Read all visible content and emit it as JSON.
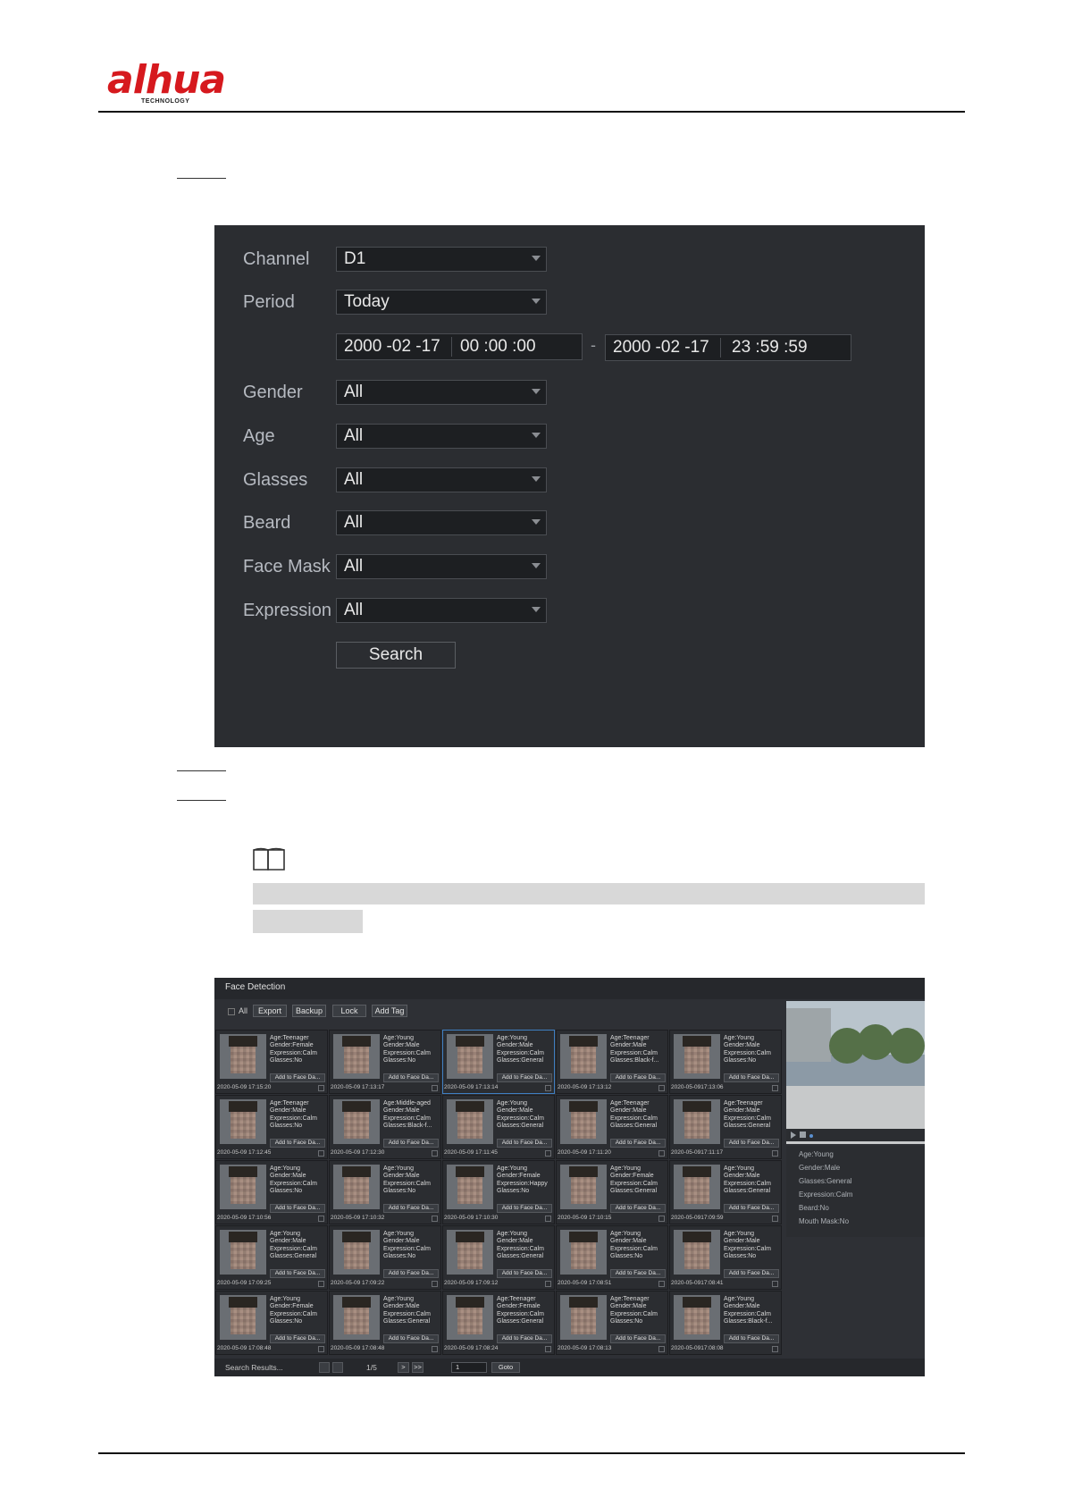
{
  "logo": {
    "brand": "alhua",
    "sub": "TECHNOLOGY"
  },
  "search_form": {
    "labels": {
      "channel": "Channel",
      "period": "Period",
      "gender": "Gender",
      "age": "Age",
      "glasses": "Glasses",
      "beard": "Beard",
      "face_mask": "Face Mask",
      "expression": "Expression"
    },
    "values": {
      "channel": "D1",
      "period": "Today",
      "gender": "All",
      "age": "All",
      "glasses": "All",
      "beard": "All",
      "face_mask": "All",
      "expression": "All"
    },
    "start_date": "2000 -02 -17",
    "start_time": "00 :00 :00",
    "end_date": "2000 -02 -17",
    "end_time": "23 :59 :59",
    "dash": "-",
    "search_label": "Search"
  },
  "results": {
    "title": "Face Detection",
    "toolbar": {
      "all": "All",
      "export": "Export",
      "backup": "Backup",
      "lock": "Lock",
      "add_tag": "Add Tag"
    },
    "add_label": "Add to Face Da...",
    "cards": [
      {
        "l1": "Age:Teenager",
        "l2": "Gender:Female",
        "l3": "Expression:Calm",
        "l4": "Glasses:No",
        "time": "2020-05-09 17:15:20"
      },
      {
        "l1": "Age:Young",
        "l2": "Gender:Male",
        "l3": "Expression:Calm",
        "l4": "Glasses:No",
        "time": "2020-05-09 17:13:17"
      },
      {
        "l1": "Age:Young",
        "l2": "Gender:Male",
        "l3": "Expression:Calm",
        "l4": "Glasses:General",
        "time": "2020-05-09 17:13:14",
        "selected": true
      },
      {
        "l1": "Age:Teenager",
        "l2": "Gender:Male",
        "l3": "Expression:Calm",
        "l4": "Glasses:Black-f...",
        "time": "2020-05-09 17:13:12"
      },
      {
        "l1": "Age:Young",
        "l2": "Gender:Male",
        "l3": "Expression:Calm",
        "l4": "Glasses:No",
        "time": "2020-05-0917:13:06"
      },
      {
        "l1": "Age:Teenager",
        "l2": "Gender:Male",
        "l3": "Expression:Calm",
        "l4": "Glasses:No",
        "time": "2020-05-09 17:12:45"
      },
      {
        "l1": "Age:Middle-aged",
        "l2": "Gender:Male",
        "l3": "Expression:Calm",
        "l4": "Glasses:Black-f...",
        "time": "2020-05-09 17:12:30"
      },
      {
        "l1": "Age:Young",
        "l2": "Gender:Male",
        "l3": "Expression:Calm",
        "l4": "Glasses:General",
        "time": "2020-05-09 17:11:45"
      },
      {
        "l1": "Age:Teenager",
        "l2": "Gender:Male",
        "l3": "Expression:Calm",
        "l4": "Glasses:General",
        "time": "2020-05-09 17:11:20"
      },
      {
        "l1": "Age:Teenager",
        "l2": "Gender:Male",
        "l3": "Expression:Calm",
        "l4": "Glasses:General",
        "time": "2020-05-0917:11:17"
      },
      {
        "l1": "Age:Young",
        "l2": "Gender:Male",
        "l3": "Expression:Calm",
        "l4": "Glasses:No",
        "time": "2020-05-09 17:10:56"
      },
      {
        "l1": "Age:Young",
        "l2": "Gender:Male",
        "l3": "Expression:Calm",
        "l4": "Glasses:No",
        "time": "2020-05-09 17:10:32"
      },
      {
        "l1": "Age:Young",
        "l2": "Gender:Female",
        "l3": "Expression:Happy",
        "l4": "Glasses:No",
        "time": "2020-05-09 17:10:30"
      },
      {
        "l1": "Age:Young",
        "l2": "Gender:Female",
        "l3": "Expression:Calm",
        "l4": "Glasses:General",
        "time": "2020-05-09 17:10:15"
      },
      {
        "l1": "Age:Young",
        "l2": "Gender:Male",
        "l3": "Expression:Calm",
        "l4": "Glasses:General",
        "time": "2020-05-0917:09:59"
      },
      {
        "l1": "Age:Young",
        "l2": "Gender:Male",
        "l3": "Expression:Calm",
        "l4": "Glasses:General",
        "time": "2020-05-09 17:09:25"
      },
      {
        "l1": "Age:Young",
        "l2": "Gender:Male",
        "l3": "Expression:Calm",
        "l4": "Glasses:No",
        "time": "2020-05-09 17:09:22"
      },
      {
        "l1": "Age:Young",
        "l2": "Gender:Male",
        "l3": "Expression:Calm",
        "l4": "Glasses:General",
        "time": "2020-05-09 17:09:12"
      },
      {
        "l1": "Age:Young",
        "l2": "Gender:Male",
        "l3": "Expression:Calm",
        "l4": "Glasses:No",
        "time": "2020-05-09 17:08:51"
      },
      {
        "l1": "Age:Young",
        "l2": "Gender:Male",
        "l3": "Expression:Calm",
        "l4": "Glasses:No",
        "time": "2020-05-0917:08:41"
      },
      {
        "l1": "Age:Young",
        "l2": "Gender:Female",
        "l3": "Expression:Calm",
        "l4": "Glasses:No",
        "time": "2020-05-09 17:08:48"
      },
      {
        "l1": "Age:Young",
        "l2": "Gender:Male",
        "l3": "Expression:Calm",
        "l4": "Glasses:General",
        "time": "2020-05-09 17:08:48"
      },
      {
        "l1": "Age:Teenager",
        "l2": "Gender:Female",
        "l3": "Expression:Calm",
        "l4": "Glasses:General",
        "time": "2020-05-09 17:08:24"
      },
      {
        "l1": "Age:Teenager",
        "l2": "Gender:Male",
        "l3": "Expression:Calm",
        "l4": "Glasses:No",
        "time": "2020-05-09 17:08:13"
      },
      {
        "l1": "Age:Young",
        "l2": "Gender:Male",
        "l3": "Expression:Calm",
        "l4": "Glasses:Black-f...",
        "time": "2020-05-0917:08:08"
      }
    ],
    "detail": {
      "age": "Age:Young",
      "gender": "Gender:Male",
      "glasses": "Glasses:General",
      "expression": "Expression:Calm",
      "beard": "Beard:No",
      "mask": "Mouth Mask:No"
    },
    "footer": {
      "status": "Search Results...",
      "page": "1/5",
      "next": ">",
      "last": ">>",
      "page_input": "1",
      "goto": "Goto"
    }
  }
}
